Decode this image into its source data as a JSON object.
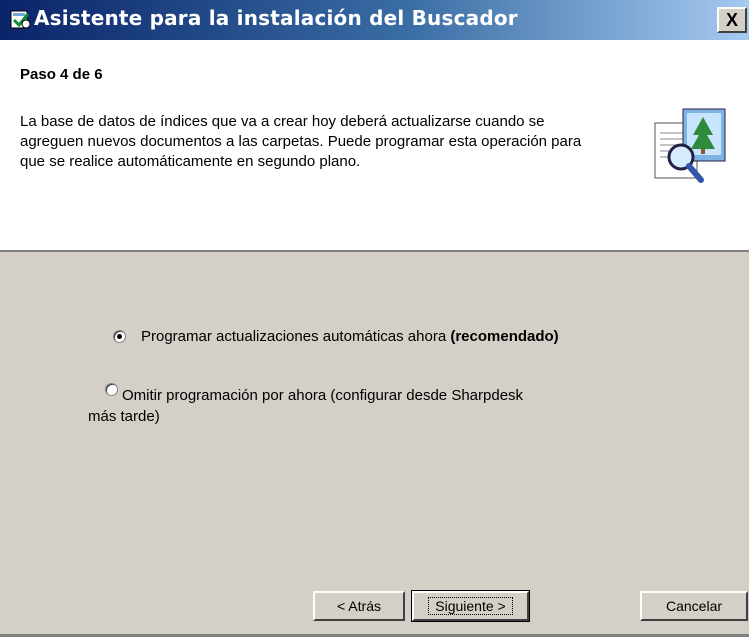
{
  "window": {
    "title": "Asistente para la instalación del Buscador",
    "close_label": "X"
  },
  "header": {
    "step": "Paso 4 de 6",
    "description": "La base de datos de índices que va a crear hoy deberá actualizarse cuando se agreguen nuevos documentos a las carpetas. Puede programar esta operación para que se realice automáticamente en segundo plano."
  },
  "options": [
    {
      "label": "Programar actualizaciones automáticas ahora ",
      "label_bold": "(recomendado)",
      "selected": true
    },
    {
      "label_line1": "Omitir programación por ahora (configurar desde Sharpdesk",
      "label_line2": "más tarde)",
      "selected": false
    }
  ],
  "buttons": {
    "back": "< Atrás",
    "next": "Siguiente >",
    "cancel": "Cancelar"
  }
}
